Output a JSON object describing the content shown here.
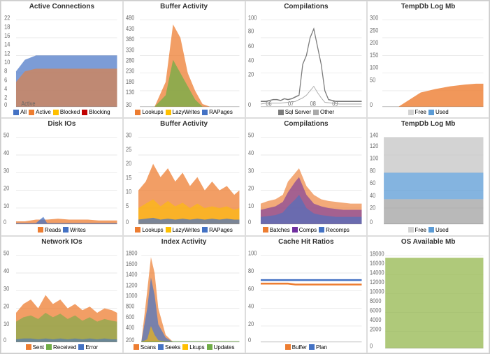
{
  "dashboard": {
    "charts": [
      {
        "id": "active-connections",
        "title": "Active Connections",
        "legend": [
          {
            "label": "All",
            "color": "#4472c4"
          },
          {
            "label": "Active",
            "color": "#ed7d31"
          },
          {
            "label": "Blocked",
            "color": "#ffc000"
          },
          {
            "label": "Blocking",
            "color": "#c00000"
          }
        ]
      },
      {
        "id": "buffer-activity",
        "title": "Buffer Activity",
        "legend": [
          {
            "label": "Lookups",
            "color": "#ed7d31"
          },
          {
            "label": "LazyWrites",
            "color": "#ffc000"
          },
          {
            "label": "RAPages",
            "color": "#4472c4"
          }
        ]
      },
      {
        "id": "compilations",
        "title": "Compilations",
        "legend": [
          {
            "label": "Sql Server",
            "color": "#7b7b7b"
          },
          {
            "label": "Other",
            "color": "#aaaaaa"
          }
        ]
      },
      {
        "id": "tempdb-log",
        "title": "TempDb Log Mb",
        "legend": [
          {
            "label": "Free",
            "color": "#d3d3d3"
          },
          {
            "label": "Used",
            "color": "#5b9bd5"
          }
        ]
      },
      {
        "id": "disk-ios",
        "title": "Disk IOs",
        "legend": [
          {
            "label": "Reads",
            "color": "#ed7d31"
          },
          {
            "label": "Writes",
            "color": "#4472c4"
          }
        ]
      },
      {
        "id": "buffer-activity2",
        "title": "Buffer Activity",
        "legend": [
          {
            "label": "Lookups",
            "color": "#ed7d31"
          },
          {
            "label": "LazyWrites",
            "color": "#ffc000"
          },
          {
            "label": "RAPages",
            "color": "#4472c4"
          }
        ]
      },
      {
        "id": "compilations2",
        "title": "Compilations",
        "legend": [
          {
            "label": "Batches",
            "color": "#ed7d31"
          },
          {
            "label": "Comps",
            "color": "#7030a0"
          },
          {
            "label": "Recomps",
            "color": "#4472c4"
          }
        ]
      },
      {
        "id": "tempdb-log2",
        "title": "TempDb Log Mb",
        "legend": [
          {
            "label": "Free",
            "color": "#d3d3d3"
          },
          {
            "label": "Used",
            "color": "#5b9bd5"
          }
        ]
      },
      {
        "id": "network-ios",
        "title": "Network IOs",
        "legend": [
          {
            "label": "Sent",
            "color": "#ed7d31"
          },
          {
            "label": "Received",
            "color": "#70ad47"
          },
          {
            "label": "Error",
            "color": "#4472c4"
          }
        ]
      },
      {
        "id": "index-activity",
        "title": "Index Activity",
        "legend": [
          {
            "label": "Scans",
            "color": "#ed7d31"
          },
          {
            "label": "Seeks",
            "color": "#4472c4"
          },
          {
            "label": "Lkups",
            "color": "#ffc000"
          },
          {
            "label": "Updates",
            "color": "#70ad47"
          }
        ]
      },
      {
        "id": "cache-hit-ratios",
        "title": "Cache Hit Ratios",
        "legend": [
          {
            "label": "Buffer",
            "color": "#ed7d31"
          },
          {
            "label": "Plan",
            "color": "#4472c4"
          }
        ]
      },
      {
        "id": "os-available-mb",
        "title": "OS Available Mb",
        "legend": []
      }
    ]
  }
}
